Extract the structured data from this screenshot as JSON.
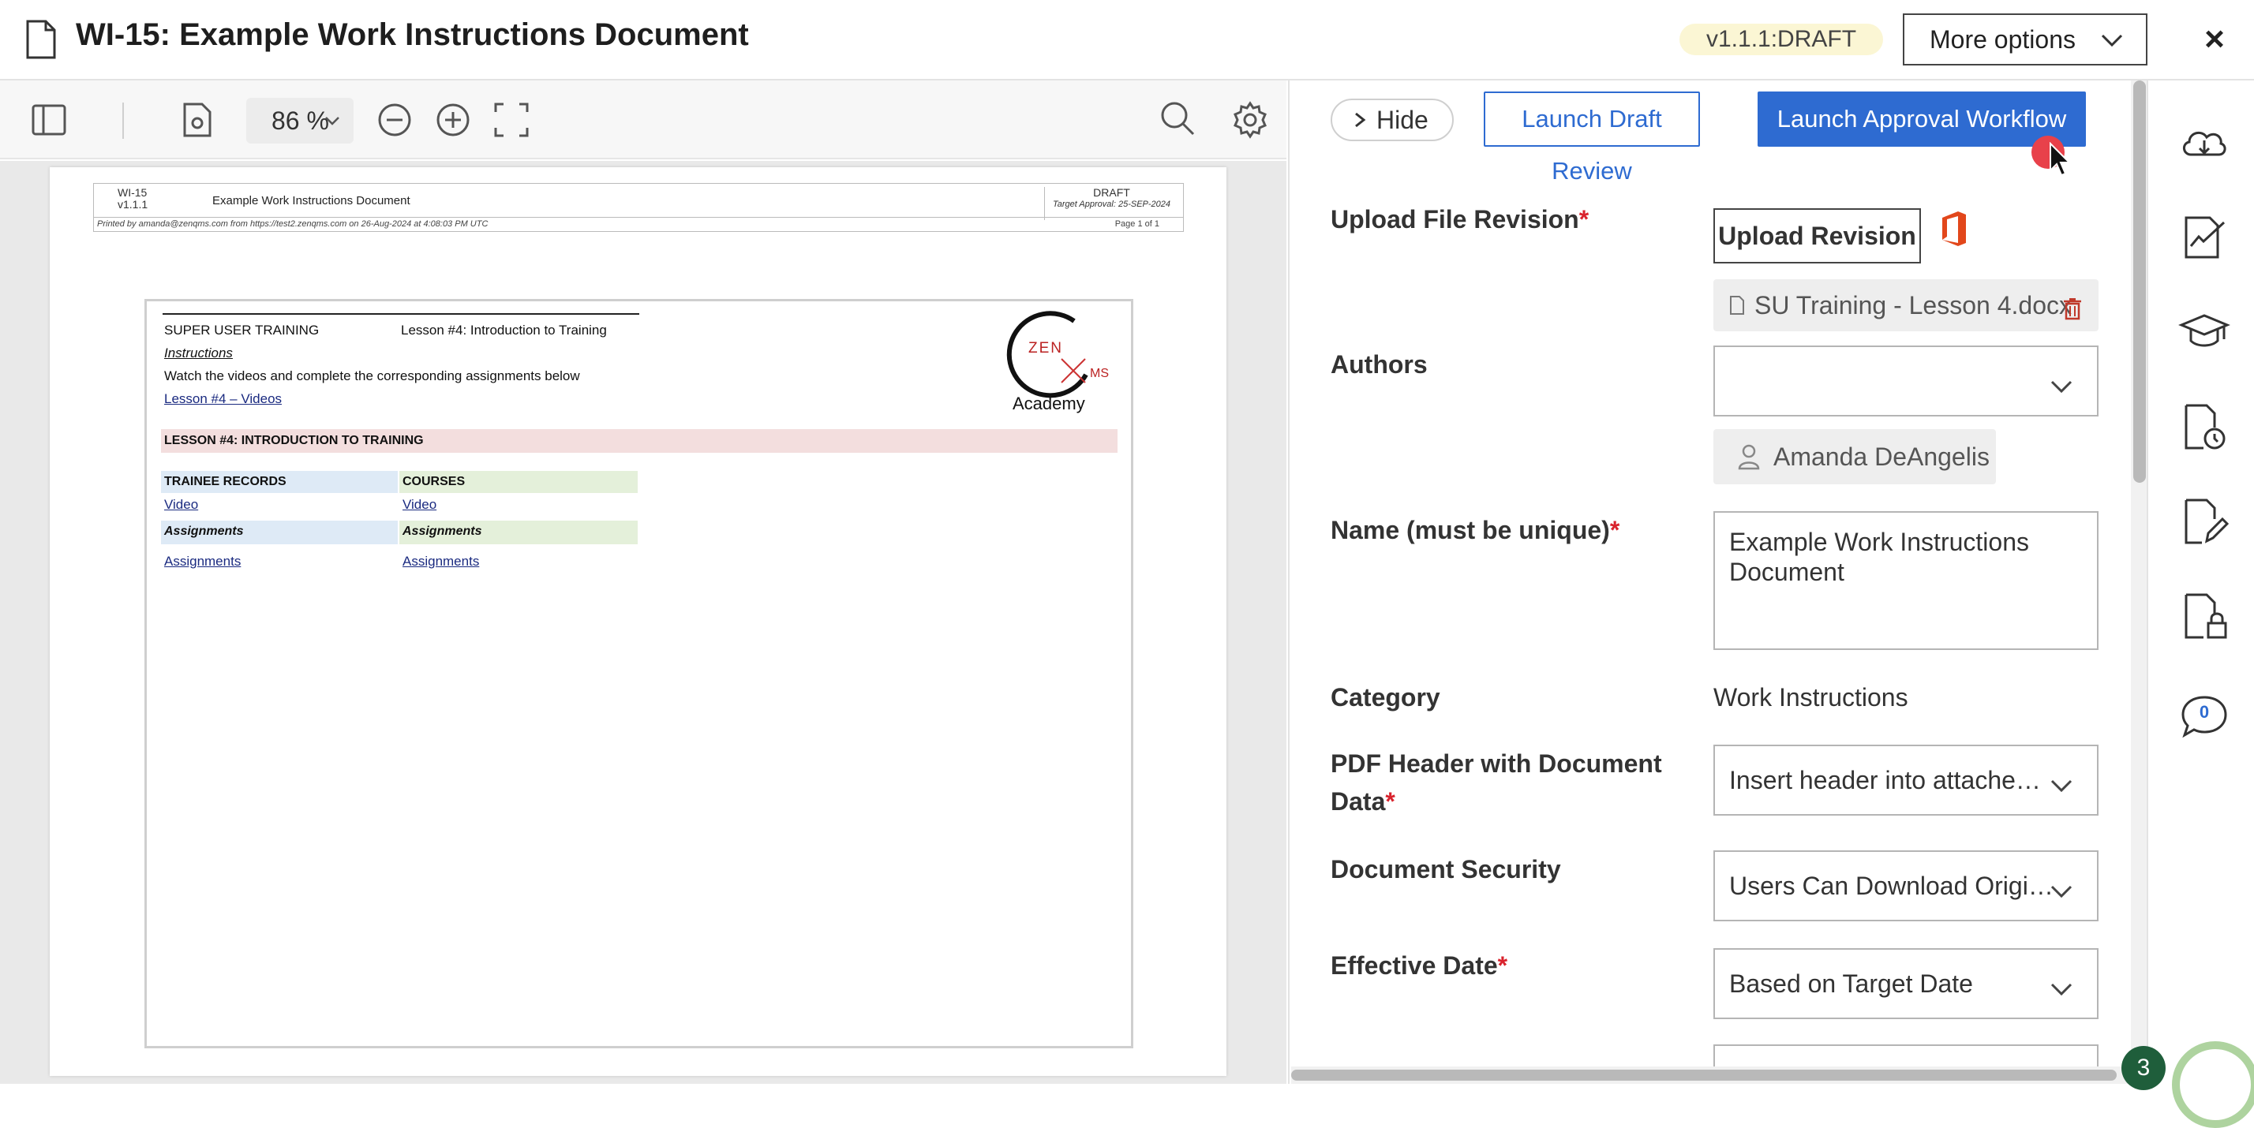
{
  "header": {
    "title": "WI-15: Example Work Instructions Document",
    "version": "v1.1.1:DRAFT",
    "more_options": "More options"
  },
  "viewer_toolbar": {
    "zoom": "86 %",
    "icons": [
      "sidebar-toggle-icon",
      "page-settings-icon",
      "zoom-out-icon",
      "zoom-in-icon",
      "fullscreen-icon",
      "search-icon",
      "settings-gear-icon"
    ]
  },
  "document": {
    "header_code": "WI-15",
    "header_version": "v1.1.1",
    "header_title": "Example Work Instructions Document",
    "header_status": "DRAFT",
    "header_target": "Target Approval: 25-SEP-2024",
    "printed_by": "Printed by amanda@zenqms.com from https://test2.zenqms.com on 26-Aug-2024 at 4:08:03 PM UTC",
    "page_of": "Page 1 of 1",
    "course_title": "SUPER USER TRAINING",
    "lesson_title": "Lesson #4: Introduction to Training",
    "instructions_heading": "Instructions",
    "instructions_text": "Watch the videos and complete the corresponding assignments below",
    "videos_link": "Lesson #4 – Videos",
    "section_banner": "LESSON #4: INTRODUCTION TO TRAINING",
    "col1_header": "TRAINEE RECORDS",
    "col2_header": "COURSES",
    "col1_video": "Video",
    "col2_video": "Video",
    "col1_assign_head": "Assignments",
    "col2_assign_head": "Assignments",
    "col1_assign_link": "Assignments",
    "col2_assign_link": "Assignments",
    "logo_text_zen": "ZEN",
    "logo_text_ms": "MS",
    "logo_text_academy": "Academy"
  },
  "panel": {
    "hide_label": "Hide",
    "draft_review_label": "Launch Draft Review",
    "approval_label": "Launch Approval Workflow",
    "upload_label": "Upload File Revision",
    "upload_button": "Upload Revision",
    "file_name": "SU Training - Lesson 4.docx",
    "authors_label": "Authors",
    "authors_value": "",
    "author_chip": "Amanda DeAngelis",
    "name_label": "Name (must be unique)",
    "name_value": "Example Work Instructions Document",
    "category_label": "Category",
    "category_value": "Work Instructions",
    "pdf_header_label_1": "PDF Header with Document",
    "pdf_header_label_2": "Data",
    "pdf_header_value": "Insert header into attache…",
    "security_label": "Document Security",
    "security_value": "Users Can Download Origi…",
    "effective_label": "Effective Date",
    "effective_value": "Based on Target Date",
    "required_mark": "*"
  },
  "rail": {
    "icons": [
      "cloud-download-icon",
      "signature-chart-icon",
      "graduation-cap-icon",
      "document-history-icon",
      "document-edit-icon",
      "document-lock-icon",
      "comments-icon"
    ],
    "comment_count": "0",
    "notification_count": "3"
  },
  "colors": {
    "primary": "#2e6bd1",
    "required": "#d9232d",
    "version_pill": "#fbf6d4",
    "click_marker": "#e8414a"
  }
}
